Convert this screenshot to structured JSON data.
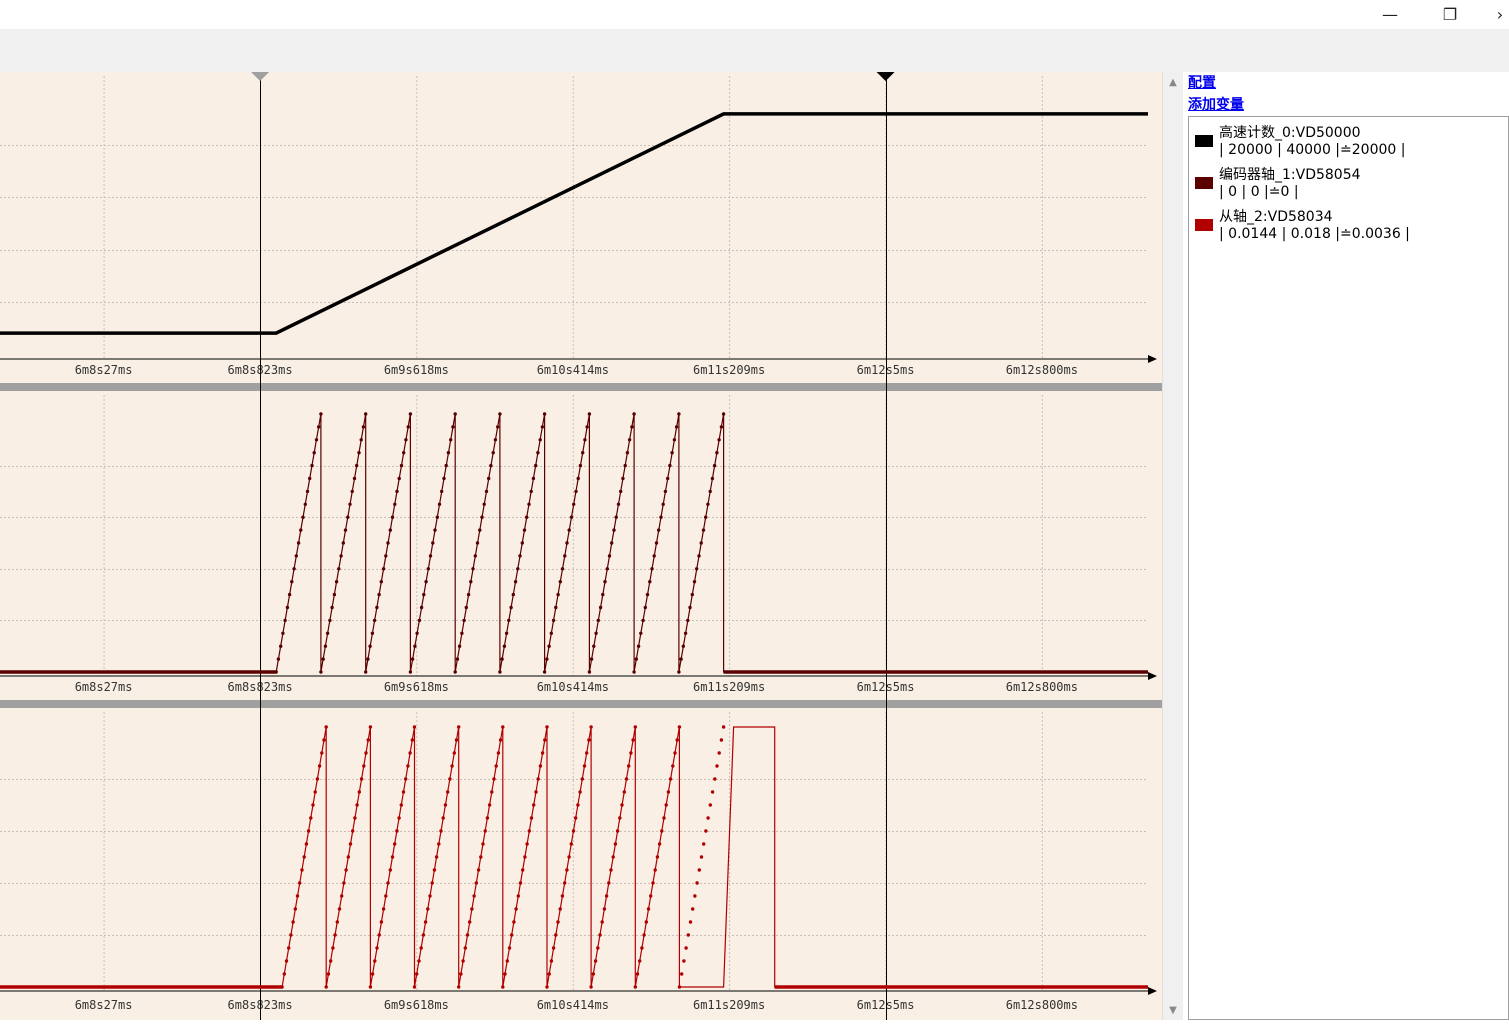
{
  "window": {
    "minimize_icon": "minimize-icon",
    "restore_icon": "restore-icon",
    "close_icon": "chevron-right-icon",
    "minimize_glyph": "—",
    "restore_glyph": "❐",
    "close_glyph": "›"
  },
  "links": {
    "config": "配置",
    "add_variable": "添加变量"
  },
  "legend": [
    {
      "name": "高速计数_0:VD50000",
      "values": "| 20000 | 40000 |≐20000 |",
      "color": "#000000"
    },
    {
      "name": "编码器轴_1:VD58054",
      "values": "| 0 | 0 |≐0 |",
      "color": "#5a0000"
    },
    {
      "name": "从轴_2:VD58034",
      "values": "| 0.0144 | 0.018 |≐0.0036 |",
      "color": "#b00000"
    }
  ],
  "colors": {
    "plot_bg": "#f9efe4",
    "grid": "#c8c0b8",
    "separator": "#a0a0a0",
    "series0": "#000000",
    "series1": "#5a0000",
    "series2": "#b00000"
  },
  "chart_data": {
    "type": "line",
    "x_unit": "ms",
    "x_tick_labels": [
      "6m8s27ms",
      "6m8s823ms",
      "6m9s618ms",
      "6m10s414ms",
      "6m11s209ms",
      "6m12s5ms",
      "6m12s800ms"
    ],
    "x_ticks": [
      368027,
      368823,
      369618,
      370414,
      371209,
      372005,
      372800
    ],
    "xlim": [
      367500,
      373340
    ],
    "cursors": [
      368823,
      372005
    ],
    "series": [
      {
        "name": "高速计数_0:VD50000",
        "style": "line",
        "ylim": [
          18000,
          42000
        ],
        "x": [
          367500,
          368905,
          371181,
          373340
        ],
        "y": [
          20000,
          20000,
          40000,
          40000
        ]
      },
      {
        "name": "编码器轴_1:VD58054",
        "style": "sawtooth",
        "ylim": [
          0,
          1
        ],
        "start": 368905,
        "end": 371181,
        "teeth": 10,
        "high": 1.0,
        "base": 0
      },
      {
        "name": "从轴_2:VD58034",
        "style": "sawtooth",
        "ylim": [
          0,
          1
        ],
        "start": 368935,
        "end": 371181,
        "teeth": 10,
        "high": 1.0,
        "hold_end": 371441,
        "hold_value": 1.0,
        "base": 0
      }
    ]
  }
}
